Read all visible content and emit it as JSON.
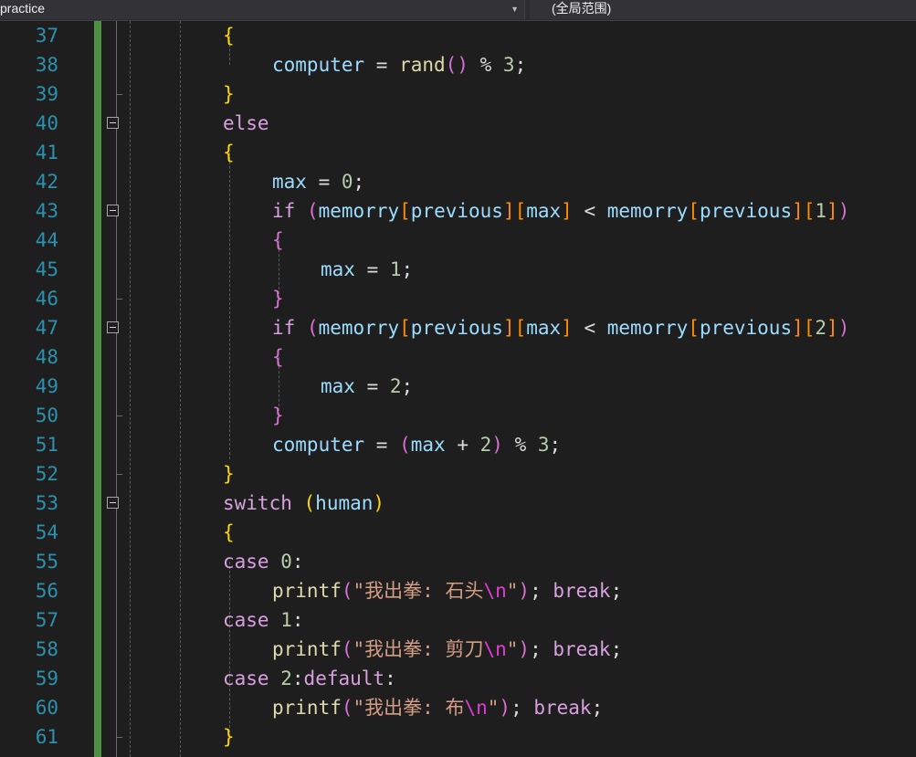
{
  "topbar": {
    "scope_left": "practice",
    "scope_right": "(全局范围)"
  },
  "lines": [
    {
      "n": "37",
      "fold": false,
      "indent": 0,
      "tokens": [
        [
          "b1",
          "{"
        ]
      ]
    },
    {
      "n": "38",
      "fold": false,
      "indent": 1,
      "tokens": [
        [
          "id",
          "computer"
        ],
        [
          "plain",
          " = "
        ],
        [
          "fn",
          "rand"
        ],
        [
          "b2",
          "()"
        ],
        [
          "plain",
          " % "
        ],
        [
          "num",
          "3"
        ],
        [
          "plain",
          ";"
        ]
      ]
    },
    {
      "n": "39",
      "fold": false,
      "indent": 0,
      "tokens": [
        [
          "b1",
          "}"
        ]
      ]
    },
    {
      "n": "40",
      "fold": true,
      "indent": 0,
      "tokens": [
        [
          "kw",
          "else"
        ]
      ]
    },
    {
      "n": "41",
      "fold": false,
      "indent": 0,
      "tokens": [
        [
          "b1",
          "{"
        ]
      ]
    },
    {
      "n": "42",
      "fold": false,
      "indent": 1,
      "tokens": [
        [
          "id",
          "max"
        ],
        [
          "plain",
          " = "
        ],
        [
          "num",
          "0"
        ],
        [
          "plain",
          ";"
        ]
      ]
    },
    {
      "n": "43",
      "fold": true,
      "indent": 1,
      "tokens": [
        [
          "kw",
          "if"
        ],
        [
          "plain",
          " "
        ],
        [
          "b2",
          "("
        ],
        [
          "id",
          "memorry"
        ],
        [
          "b3",
          "["
        ],
        [
          "id",
          "previous"
        ],
        [
          "b3",
          "]["
        ],
        [
          "id",
          "max"
        ],
        [
          "b3",
          "]"
        ],
        [
          "plain",
          " < "
        ],
        [
          "id",
          "memorry"
        ],
        [
          "b3",
          "["
        ],
        [
          "id",
          "previous"
        ],
        [
          "b3",
          "]["
        ],
        [
          "num",
          "1"
        ],
        [
          "b3",
          "]"
        ],
        [
          "b2",
          ")"
        ]
      ]
    },
    {
      "n": "44",
      "fold": false,
      "indent": 1,
      "tokens": [
        [
          "b2",
          "{"
        ]
      ]
    },
    {
      "n": "45",
      "fold": false,
      "indent": 2,
      "tokens": [
        [
          "id",
          "max"
        ],
        [
          "plain",
          " = "
        ],
        [
          "num",
          "1"
        ],
        [
          "plain",
          ";"
        ]
      ]
    },
    {
      "n": "46",
      "fold": false,
      "indent": 1,
      "tokens": [
        [
          "b2",
          "}"
        ]
      ]
    },
    {
      "n": "47",
      "fold": true,
      "indent": 1,
      "tokens": [
        [
          "kw",
          "if"
        ],
        [
          "plain",
          " "
        ],
        [
          "b2",
          "("
        ],
        [
          "id",
          "memorry"
        ],
        [
          "b3",
          "["
        ],
        [
          "id",
          "previous"
        ],
        [
          "b3",
          "]["
        ],
        [
          "id",
          "max"
        ],
        [
          "b3",
          "]"
        ],
        [
          "plain",
          " < "
        ],
        [
          "id",
          "memorry"
        ],
        [
          "b3",
          "["
        ],
        [
          "id",
          "previous"
        ],
        [
          "b3",
          "]["
        ],
        [
          "num",
          "2"
        ],
        [
          "b3",
          "]"
        ],
        [
          "b2",
          ")"
        ]
      ]
    },
    {
      "n": "48",
      "fold": false,
      "indent": 1,
      "tokens": [
        [
          "b2",
          "{"
        ]
      ]
    },
    {
      "n": "49",
      "fold": false,
      "indent": 2,
      "tokens": [
        [
          "id",
          "max"
        ],
        [
          "plain",
          " = "
        ],
        [
          "num",
          "2"
        ],
        [
          "plain",
          ";"
        ]
      ]
    },
    {
      "n": "50",
      "fold": false,
      "indent": 1,
      "tokens": [
        [
          "b2",
          "}"
        ]
      ]
    },
    {
      "n": "51",
      "fold": false,
      "indent": 1,
      "tokens": [
        [
          "id",
          "computer"
        ],
        [
          "plain",
          " = "
        ],
        [
          "b2",
          "("
        ],
        [
          "id",
          "max"
        ],
        [
          "plain",
          " + "
        ],
        [
          "num",
          "2"
        ],
        [
          "b2",
          ")"
        ],
        [
          "plain",
          " % "
        ],
        [
          "num",
          "3"
        ],
        [
          "plain",
          ";"
        ]
      ]
    },
    {
      "n": "52",
      "fold": false,
      "indent": 0,
      "tokens": [
        [
          "b1",
          "}"
        ]
      ]
    },
    {
      "n": "53",
      "fold": true,
      "indent": 0,
      "tokens": [
        [
          "kw",
          "switch"
        ],
        [
          "plain",
          " "
        ],
        [
          "b1",
          "("
        ],
        [
          "id",
          "human"
        ],
        [
          "b1",
          ")"
        ]
      ]
    },
    {
      "n": "54",
      "fold": false,
      "indent": 0,
      "tokens": [
        [
          "b1",
          "{"
        ]
      ]
    },
    {
      "n": "55",
      "fold": false,
      "indent": 0,
      "tokens": [
        [
          "kw",
          "case"
        ],
        [
          "plain",
          " "
        ],
        [
          "num",
          "0"
        ],
        [
          "plain",
          ":"
        ]
      ]
    },
    {
      "n": "56",
      "fold": false,
      "indent": 1,
      "tokens": [
        [
          "fn",
          "printf"
        ],
        [
          "b2",
          "("
        ],
        [
          "str",
          "\"我出拳: 石头"
        ],
        [
          "esc",
          "\\n"
        ],
        [
          "str",
          "\""
        ],
        [
          "b2",
          ")"
        ],
        [
          "plain",
          "; "
        ],
        [
          "kw",
          "break"
        ],
        [
          "plain",
          ";"
        ]
      ]
    },
    {
      "n": "57",
      "fold": false,
      "indent": 0,
      "tokens": [
        [
          "kw",
          "case"
        ],
        [
          "plain",
          " "
        ],
        [
          "num",
          "1"
        ],
        [
          "plain",
          ":"
        ]
      ]
    },
    {
      "n": "58",
      "fold": false,
      "indent": 1,
      "tokens": [
        [
          "fn",
          "printf"
        ],
        [
          "b2",
          "("
        ],
        [
          "str",
          "\"我出拳: 剪刀"
        ],
        [
          "esc",
          "\\n"
        ],
        [
          "str",
          "\""
        ],
        [
          "b2",
          ")"
        ],
        [
          "plain",
          "; "
        ],
        [
          "kw",
          "break"
        ],
        [
          "plain",
          ";"
        ]
      ]
    },
    {
      "n": "59",
      "fold": false,
      "indent": 0,
      "tokens": [
        [
          "kw",
          "case"
        ],
        [
          "plain",
          " "
        ],
        [
          "num",
          "2"
        ],
        [
          "plain",
          ":"
        ],
        [
          "kw",
          "default"
        ],
        [
          "plain",
          ":"
        ]
      ]
    },
    {
      "n": "60",
      "fold": false,
      "indent": 1,
      "tokens": [
        [
          "fn",
          "printf"
        ],
        [
          "b2",
          "("
        ],
        [
          "str",
          "\"我出拳: 布"
        ],
        [
          "esc",
          "\\n"
        ],
        [
          "str",
          "\""
        ],
        [
          "b2",
          ")"
        ],
        [
          "plain",
          "; "
        ],
        [
          "kw",
          "break"
        ],
        [
          "plain",
          ";"
        ]
      ]
    },
    {
      "n": "61",
      "fold": false,
      "indent": 0,
      "tokens": [
        [
          "b1",
          "}"
        ]
      ]
    }
  ]
}
